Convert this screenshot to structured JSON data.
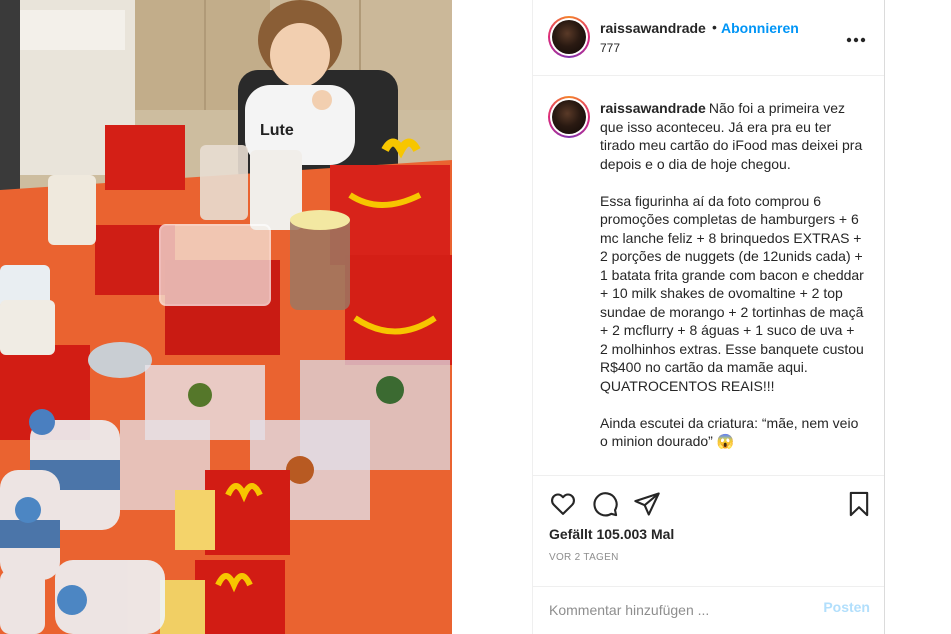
{
  "post": {
    "username": "raissawandrade",
    "separator": "•",
    "follow_label": "Abonnieren",
    "location": "777",
    "more_label": "•••",
    "photo_alt": "",
    "caption_username": "raissawandrade",
    "caption_text": "Não foi a primeira vez que isso aconteceu. Já era pra eu ter tirado meu cartão do iFood mas deixei pra depois e o dia de hoje chegou.\n\nEssa figurinha aí da foto comprou 6 promoções completas de hamburgers + 6 mc lanche feliz + 8 brinquedos EXTRAS + 2 porções de nuggets (de 12unids cada) + 1 batata frita grande com bacon e cheddar + 10 milk shakes de ovomaltine + 2 top sundae de morango + 2 tortinhas de maçã + 2 mcflurry + 8 águas + 1 suco de uva + 2 molhinhos extras. Esse banquete custou R$400 no cartão da mamãe aqui. QUATROCENTOS REAIS!!!\n\nAinda escutei da criatura: “mãe, nem veio o minion dourado” 😱",
    "likes_label": "Gefällt 105.003 Mal",
    "timestamp": "VOR 2 TAGEN",
    "comment_placeholder": "Kommentar hinzufügen ...",
    "post_button": "Posten"
  },
  "icons": {
    "like": "heart-icon",
    "comment": "comment-bubble-icon",
    "share": "paper-plane-icon",
    "save": "bookmark-icon",
    "more": "more-options-icon"
  },
  "colors": {
    "follow": "#0095f6",
    "post_disabled": "#b2dffc",
    "muted": "#8e8e8e",
    "text": "#262626"
  }
}
